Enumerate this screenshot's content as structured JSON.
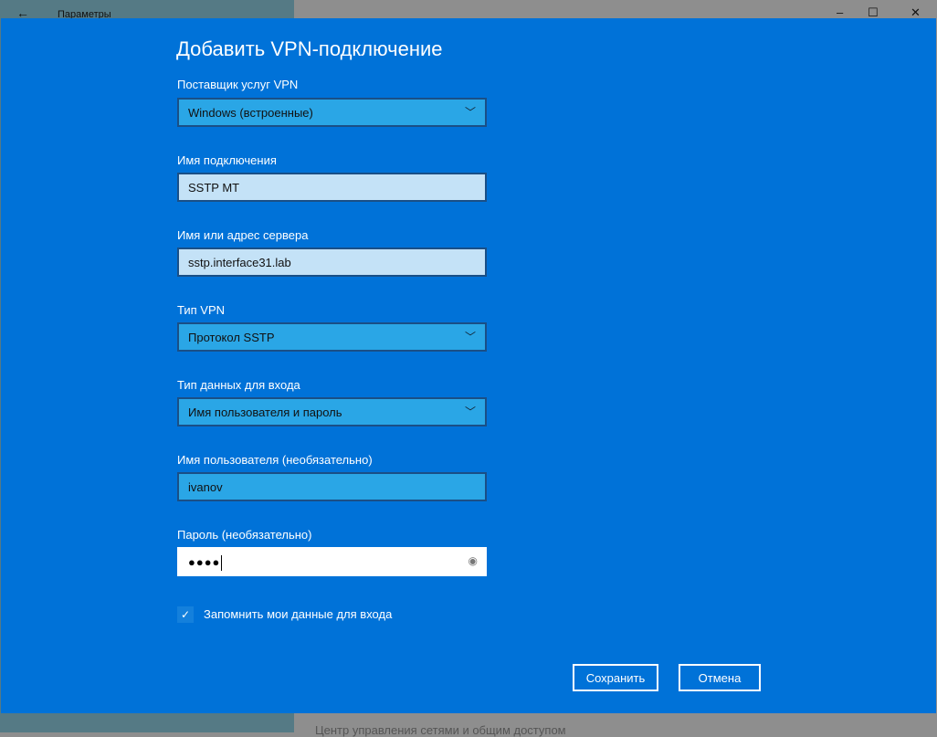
{
  "window": {
    "title": "Параметры",
    "back_icon": "←",
    "minimize": "–",
    "maximize": "☐",
    "close": "✕"
  },
  "background_text": "Центр управления сетями и общим доступом",
  "dialog": {
    "title": "Добавить VPN-подключение",
    "provider": {
      "label": "Поставщик услуг VPN",
      "value": "Windows (встроенные)"
    },
    "connection_name": {
      "label": "Имя подключения",
      "value": "SSTP MT"
    },
    "server": {
      "label": "Имя или адрес сервера",
      "value": "sstp.interface31.lab"
    },
    "vpn_type": {
      "label": "Тип VPN",
      "value": "Протокол SSTP"
    },
    "signin_type": {
      "label": "Тип данных для входа",
      "value": "Имя пользователя и пароль"
    },
    "username": {
      "label": "Имя пользователя (необязательно)",
      "value": "ivanov"
    },
    "password": {
      "label": "Пароль (необязательно)",
      "value": "●●●●"
    },
    "remember": {
      "label": "Запомнить мои данные для входа",
      "checked": true
    },
    "save": "Сохранить",
    "cancel": "Отмена"
  }
}
